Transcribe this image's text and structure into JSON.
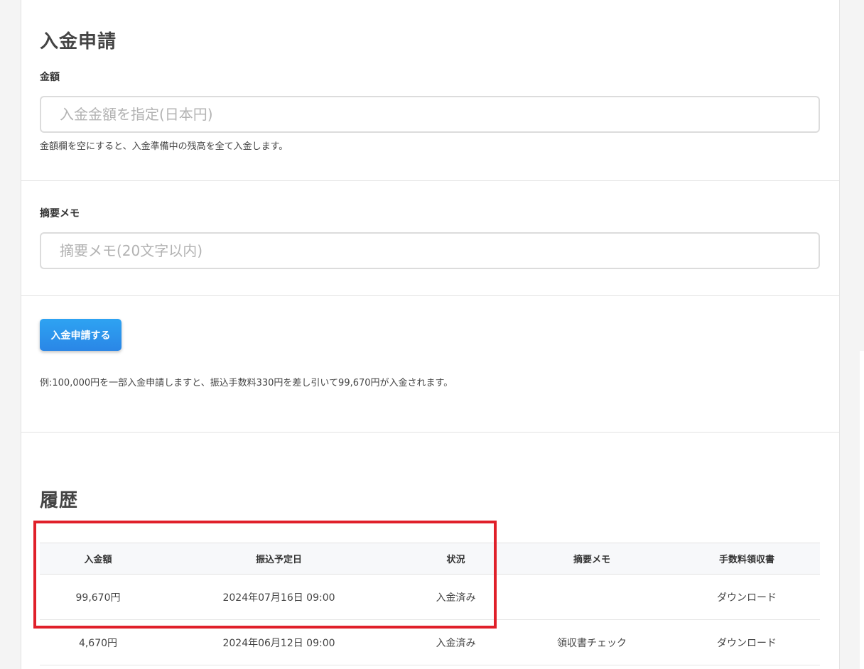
{
  "deposit_form": {
    "title": "入金申請",
    "amount": {
      "label": "金額",
      "placeholder": "入金金額を指定(日本円)",
      "value": "",
      "help": "金額欄を空にすると、入金準備中の残高を全て入金します。"
    },
    "memo": {
      "label": "摘要メモ",
      "placeholder": "摘要メモ(20文字以内)",
      "value": ""
    },
    "submit_label": "入金申請する",
    "example_note": "例:100,000円を一部入金申請しますと、振込手数料330円を差し引いて99,670円が入金されます。"
  },
  "history": {
    "title": "履歴",
    "columns": [
      "入金額",
      "振込予定日",
      "状況",
      "摘要メモ",
      "手数料領収書"
    ],
    "rows": [
      {
        "amount": "99,670円",
        "date": "2024年07月16日 09:00",
        "status": "入金済み",
        "memo": "",
        "receipt": "ダウンロード"
      },
      {
        "amount": "4,670円",
        "date": "2024年06月12日 09:00",
        "status": "入金済み",
        "memo": "領収書チェック",
        "receipt": "ダウンロード"
      }
    ]
  },
  "colors": {
    "primary_button": "#2a8fea",
    "highlight_border": "#e0202a",
    "page_background": "#f4f4f4",
    "card_background": "#ffffff"
  }
}
